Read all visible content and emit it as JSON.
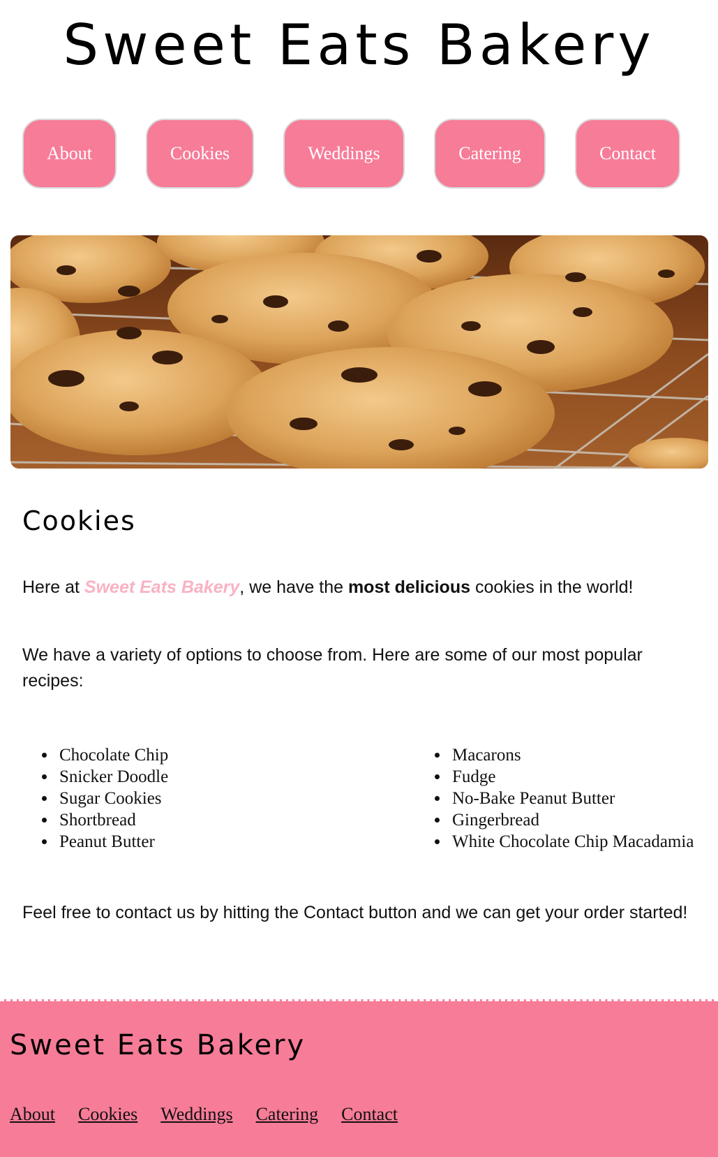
{
  "header": {
    "title": "Sweet Eats Bakery"
  },
  "nav": {
    "items": [
      {
        "label": "About"
      },
      {
        "label": "Cookies"
      },
      {
        "label": "Weddings"
      },
      {
        "label": "Catering"
      },
      {
        "label": "Contact"
      }
    ]
  },
  "main": {
    "title": "Cookies",
    "intro": {
      "before": "Here at ",
      "brand": "Sweet Eats Bakery",
      "middle": ", we have the ",
      "emphasis": "most delicious",
      "after": " cookies in the world!"
    },
    "variety_text": "We have a variety of options to choose from. Here are some of our most popular recipes:",
    "recipes_left": [
      "Chocolate Chip",
      "Snicker Doodle",
      "Sugar Cookies",
      "Shortbread",
      "Peanut Butter"
    ],
    "recipes_right": [
      "Macarons",
      "Fudge",
      "No-Bake Peanut Butter",
      "Gingerbread",
      "White Chocolate Chip Macadamia"
    ],
    "contact_text": "Feel free to contact us by hitting the Contact button and we can get your order started!"
  },
  "footer": {
    "title": "Sweet Eats Bakery",
    "links": [
      {
        "label": "About"
      },
      {
        "label": "Cookies"
      },
      {
        "label": "Weddings"
      },
      {
        "label": "Catering"
      },
      {
        "label": "Contact"
      }
    ]
  },
  "colors": {
    "accent_pink": "#f77c98",
    "brand_text_pink": "#f9b2c3",
    "nav_text": "#ffffff"
  }
}
